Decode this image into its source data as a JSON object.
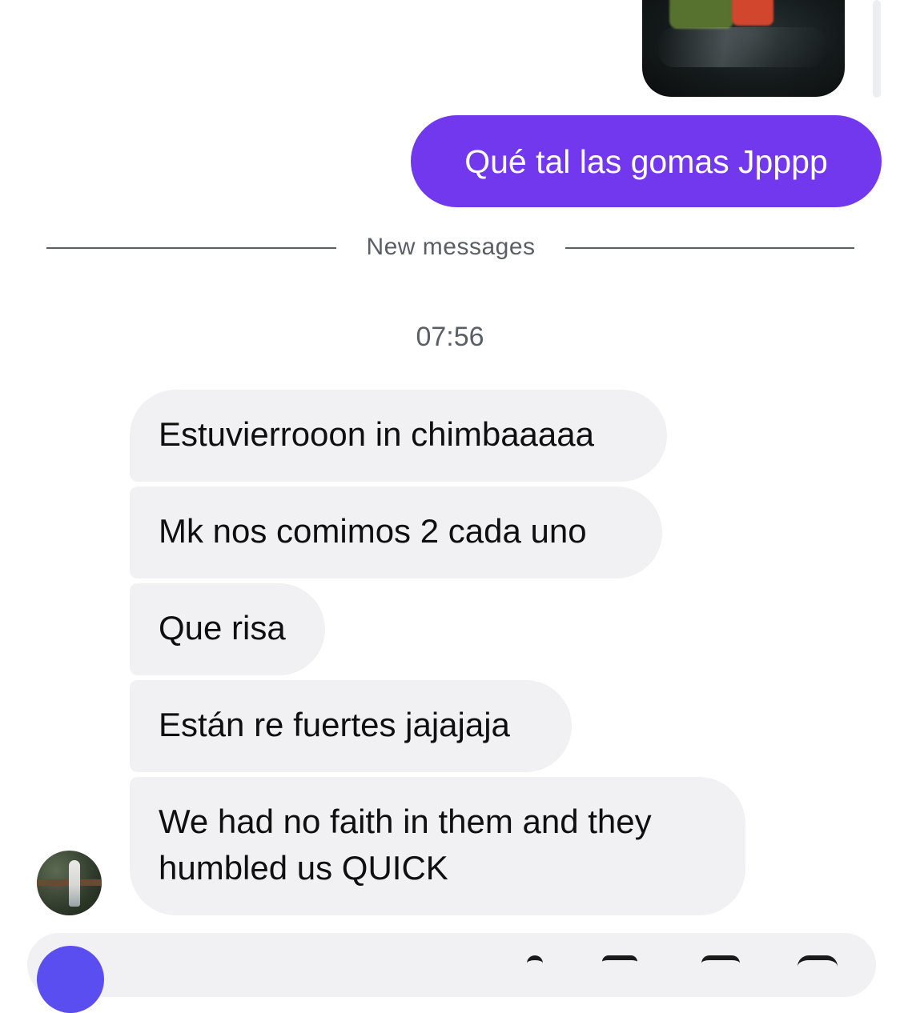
{
  "thread": {
    "sent_message": "Qué tal las gomas Jpppp",
    "new_messages_label": "New messages",
    "timestamp": "07:56",
    "received_messages": [
      "Estuvierrooon in chimbaaaaa",
      "Mk nos comimos 2 cada uno",
      "Que risa",
      "Están re fuertes jajajaja",
      "We had no faith in them and they humbled us QUICK"
    ]
  },
  "colors": {
    "sent_bubble": "#7238ed",
    "received_bubble": "#f1f1f4",
    "meta_text": "#5a5f66",
    "camera_button": "#5b4ef0"
  },
  "icons": {
    "photo": "sent-photo-image",
    "avatar": "contact-avatar",
    "composer": [
      "camera-icon",
      "microphone-icon",
      "gallery-icon",
      "sticker-icon",
      "add-icon"
    ]
  }
}
